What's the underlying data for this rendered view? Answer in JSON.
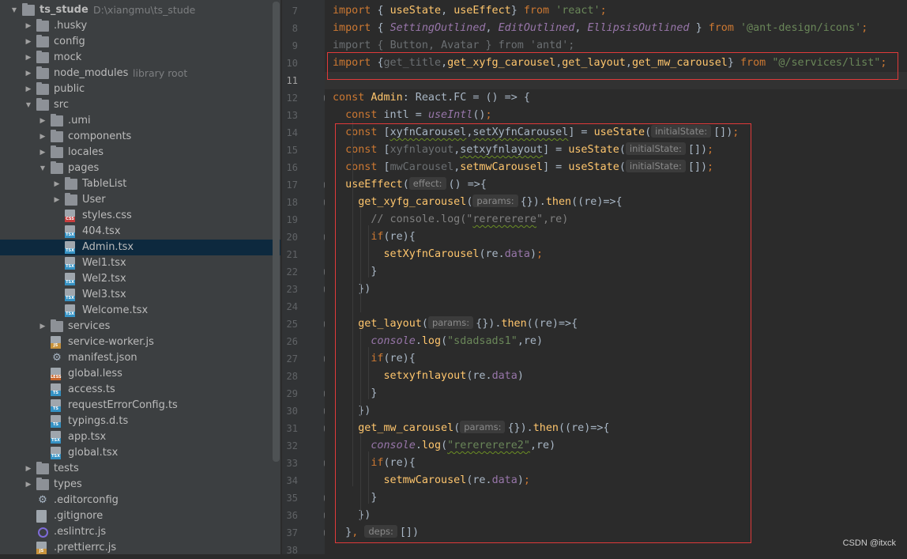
{
  "tree": [
    {
      "label": "ts_stude",
      "extra": "D:\\xiangmu\\ts_stude",
      "type": "folder",
      "depth": 0,
      "arrow": "down",
      "bold": true
    },
    {
      "label": ".husky",
      "type": "folder",
      "depth": 1,
      "arrow": "right"
    },
    {
      "label": "config",
      "type": "folder",
      "depth": 1,
      "arrow": "right"
    },
    {
      "label": "mock",
      "type": "folder",
      "depth": 1,
      "arrow": "right"
    },
    {
      "label": "node_modules",
      "extra": "library root",
      "type": "folder",
      "depth": 1,
      "arrow": "right",
      "highlight": true
    },
    {
      "label": "public",
      "type": "folder",
      "depth": 1,
      "arrow": "right"
    },
    {
      "label": "src",
      "type": "folder",
      "depth": 1,
      "arrow": "down"
    },
    {
      "label": ".umi",
      "type": "folder",
      "depth": 2,
      "arrow": "right"
    },
    {
      "label": "components",
      "type": "folder",
      "depth": 2,
      "arrow": "right"
    },
    {
      "label": "locales",
      "type": "folder",
      "depth": 2,
      "arrow": "right"
    },
    {
      "label": "pages",
      "type": "folder",
      "depth": 2,
      "arrow": "down"
    },
    {
      "label": "TableList",
      "type": "folder",
      "depth": 3,
      "arrow": "right"
    },
    {
      "label": "User",
      "type": "folder",
      "depth": 3,
      "arrow": "right"
    },
    {
      "label": "styles.css",
      "type": "file",
      "badge": "css",
      "depth": 3
    },
    {
      "label": "404.tsx",
      "type": "file",
      "badge": "tsx",
      "depth": 3
    },
    {
      "label": "Admin.tsx",
      "type": "file",
      "badge": "tsx",
      "depth": 3,
      "selected": true
    },
    {
      "label": "Wel1.tsx",
      "type": "file",
      "badge": "tsx",
      "depth": 3
    },
    {
      "label": "Wel2.tsx",
      "type": "file",
      "badge": "tsx",
      "depth": 3
    },
    {
      "label": "Wel3.tsx",
      "type": "file",
      "badge": "tsx",
      "depth": 3
    },
    {
      "label": "Welcome.tsx",
      "type": "file",
      "badge": "tsx",
      "depth": 3
    },
    {
      "label": "services",
      "type": "folder",
      "depth": 2,
      "arrow": "right"
    },
    {
      "label": "service-worker.js",
      "type": "file",
      "badge": "js",
      "depth": 2
    },
    {
      "label": "manifest.json",
      "type": "gear",
      "depth": 2
    },
    {
      "label": "global.less",
      "type": "file",
      "badge": "less",
      "depth": 2
    },
    {
      "label": "access.ts",
      "type": "file",
      "badge": "ts",
      "depth": 2
    },
    {
      "label": "requestErrorConfig.ts",
      "type": "file",
      "badge": "ts",
      "depth": 2
    },
    {
      "label": "typings.d.ts",
      "type": "file",
      "badge": "ts",
      "depth": 2
    },
    {
      "label": "app.tsx",
      "type": "file",
      "badge": "tsx",
      "depth": 2
    },
    {
      "label": "global.tsx",
      "type": "file",
      "badge": "tsx",
      "depth": 2
    },
    {
      "label": "tests",
      "type": "folder",
      "depth": 1,
      "arrow": "right"
    },
    {
      "label": "types",
      "type": "folder",
      "depth": 1,
      "arrow": "right"
    },
    {
      "label": ".editorconfig",
      "type": "gear",
      "depth": 1
    },
    {
      "label": ".gitignore",
      "type": "file",
      "badge": "",
      "depth": 1
    },
    {
      "label": ".eslintrc.js",
      "type": "ring",
      "depth": 1
    },
    {
      "label": ".prettierrc.js",
      "type": "file",
      "badge": "js",
      "depth": 1
    }
  ],
  "line_numbers": [
    "7",
    "8",
    "9",
    "10",
    "11",
    "12",
    "13",
    "14",
    "15",
    "16",
    "17",
    "18",
    "19",
    "20",
    "21",
    "22",
    "23",
    "24",
    "25",
    "26",
    "27",
    "28",
    "29",
    "30",
    "31",
    "32",
    "33",
    "34",
    "35",
    "36",
    "37",
    "38"
  ],
  "current_line": "11",
  "code": [
    [
      [
        "k",
        "import "
      ],
      [
        "v",
        "{ "
      ],
      [
        "f",
        "useState"
      ],
      [
        "v",
        ", "
      ],
      [
        "f",
        "useEffect"
      ],
      [
        "v",
        "} "
      ],
      [
        "k",
        "from "
      ],
      [
        "s",
        "'react'"
      ],
      [
        "k",
        ";"
      ]
    ],
    [
      [
        "k",
        "import "
      ],
      [
        "v",
        "{ "
      ],
      [
        "i",
        "SettingOutlined"
      ],
      [
        "v",
        ", "
      ],
      [
        "i",
        "EditOutlined"
      ],
      [
        "v",
        ", "
      ],
      [
        "i",
        "EllipsisOutlined "
      ],
      [
        "v",
        "} "
      ],
      [
        "k",
        "from "
      ],
      [
        "s",
        "'@ant-design/icons'"
      ],
      [
        "k",
        ";"
      ]
    ],
    [
      [
        "faded",
        "import { "
      ],
      [
        "faded",
        "Button"
      ],
      [
        "faded",
        ", "
      ],
      [
        "faded",
        "Avatar"
      ],
      [
        "faded",
        " } from 'antd';"
      ]
    ],
    [
      [
        "k",
        "import "
      ],
      [
        "v",
        "{"
      ],
      [
        "faded",
        "get_title"
      ],
      [
        "v",
        ","
      ],
      [
        "f",
        "get_xyfg_carousel"
      ],
      [
        "v",
        ","
      ],
      [
        "f",
        "get_layout"
      ],
      [
        "v",
        ","
      ],
      [
        "f",
        "get_mw_carousel"
      ],
      [
        "v",
        "} "
      ],
      [
        "k",
        "from "
      ],
      [
        "s",
        "\"@/services/list\""
      ],
      [
        "k",
        ";"
      ]
    ],
    [],
    [
      [
        "k",
        "const "
      ],
      [
        "f",
        "Admin"
      ],
      [
        "v",
        ": React.FC = () => {"
      ]
    ],
    [
      [
        "v",
        "  "
      ],
      [
        "k",
        "const "
      ],
      [
        "v",
        "intl = "
      ],
      [
        "i",
        "useIntl"
      ],
      [
        "v",
        "()"
      ],
      [
        "k",
        ";"
      ]
    ],
    [
      [
        "v",
        "  "
      ],
      [
        "k",
        "const "
      ],
      [
        "v",
        "["
      ],
      [
        "wavy",
        "xyfnCarousel"
      ],
      [
        "v",
        ","
      ],
      [
        "wavy",
        "setXyfnCarousel"
      ],
      [
        "v",
        "] = "
      ],
      [
        "f",
        "useState"
      ],
      [
        "v",
        "("
      ],
      [
        "hint",
        "initialState:"
      ],
      [
        "v",
        "[])"
      ],
      [
        "k",
        ";"
      ]
    ],
    [
      [
        "v",
        "  "
      ],
      [
        "k",
        "const "
      ],
      [
        "v",
        "["
      ],
      [
        "faded",
        "xyfnlayout"
      ],
      [
        "v",
        ","
      ],
      [
        "wavy",
        "setxyfnlayout"
      ],
      [
        "v",
        "] = "
      ],
      [
        "f",
        "useState"
      ],
      [
        "v",
        "("
      ],
      [
        "hint",
        "initialState:"
      ],
      [
        "v",
        "[])"
      ],
      [
        "k",
        ";"
      ]
    ],
    [
      [
        "v",
        "  "
      ],
      [
        "k",
        "const "
      ],
      [
        "v",
        "["
      ],
      [
        "faded",
        "mwCarousel"
      ],
      [
        "v",
        ","
      ],
      [
        "f",
        "setmwCarousel"
      ],
      [
        "v",
        "] = "
      ],
      [
        "f",
        "useState"
      ],
      [
        "v",
        "("
      ],
      [
        "hint",
        "initialState:"
      ],
      [
        "v",
        "[])"
      ],
      [
        "k",
        ";"
      ]
    ],
    [
      [
        "v",
        "  "
      ],
      [
        "f",
        "useEffect"
      ],
      [
        "v",
        "("
      ],
      [
        "hint",
        "effect:"
      ],
      [
        "v",
        "() =>{"
      ]
    ],
    [
      [
        "v",
        "    "
      ],
      [
        "f",
        "get_xyfg_carousel"
      ],
      [
        "v",
        "("
      ],
      [
        "hint",
        "params:"
      ],
      [
        "v",
        "{})."
      ],
      [
        "f",
        "then"
      ],
      [
        "v",
        "((re)=>{"
      ]
    ],
    [
      [
        "v",
        "      "
      ],
      [
        "c",
        "// console.log(\""
      ],
      [
        "cw",
        "rerererere"
      ],
      [
        "c",
        "\",re)"
      ]
    ],
    [
      [
        "v",
        "      "
      ],
      [
        "k",
        "if"
      ],
      [
        "v",
        "(re){"
      ]
    ],
    [
      [
        "v",
        "        "
      ],
      [
        "f",
        "setXyfnCarousel"
      ],
      [
        "v",
        "(re."
      ],
      [
        "p",
        "data"
      ],
      [
        "v",
        ")"
      ],
      [
        "k",
        ";"
      ]
    ],
    [
      [
        "v",
        "      }"
      ]
    ],
    [
      [
        "v",
        "    })"
      ]
    ],
    [],
    [
      [
        "v",
        "    "
      ],
      [
        "f",
        "get_layout"
      ],
      [
        "v",
        "("
      ],
      [
        "hint",
        "params:"
      ],
      [
        "v",
        "{})."
      ],
      [
        "f",
        "then"
      ],
      [
        "v",
        "((re)=>{"
      ]
    ],
    [
      [
        "v",
        "      "
      ],
      [
        "i",
        "console"
      ],
      [
        "v",
        "."
      ],
      [
        "f",
        "log"
      ],
      [
        "v",
        "("
      ],
      [
        "s",
        "\"sdadsads1\""
      ],
      [
        "v",
        ",re)"
      ]
    ],
    [
      [
        "v",
        "      "
      ],
      [
        "k",
        "if"
      ],
      [
        "v",
        "(re){"
      ]
    ],
    [
      [
        "v",
        "        "
      ],
      [
        "f",
        "setxyfnlayout"
      ],
      [
        "v",
        "(re."
      ],
      [
        "p",
        "data"
      ],
      [
        "v",
        ")"
      ]
    ],
    [
      [
        "v",
        "      }"
      ]
    ],
    [
      [
        "v",
        "    })"
      ]
    ],
    [
      [
        "v",
        "    "
      ],
      [
        "f",
        "get_mw_carousel"
      ],
      [
        "v",
        "("
      ],
      [
        "hint",
        "params:"
      ],
      [
        "v",
        "{})."
      ],
      [
        "f",
        "then"
      ],
      [
        "v",
        "((re)=>{"
      ]
    ],
    [
      [
        "v",
        "      "
      ],
      [
        "i",
        "console"
      ],
      [
        "v",
        "."
      ],
      [
        "f",
        "log"
      ],
      [
        "v",
        "("
      ],
      [
        "sw",
        "\"rerererere2\""
      ],
      [
        "v",
        ",re)"
      ]
    ],
    [
      [
        "v",
        "      "
      ],
      [
        "k",
        "if"
      ],
      [
        "v",
        "(re){"
      ]
    ],
    [
      [
        "v",
        "        "
      ],
      [
        "f",
        "setmwCarousel"
      ],
      [
        "v",
        "(re."
      ],
      [
        "p",
        "data"
      ],
      [
        "v",
        ")"
      ],
      [
        "k",
        ";"
      ]
    ],
    [
      [
        "v",
        "      }"
      ]
    ],
    [
      [
        "v",
        "    })"
      ]
    ],
    [
      [
        "v",
        "  }"
      ],
      [
        "k",
        ","
      ],
      [
        "v",
        " "
      ],
      [
        "hint",
        "deps:"
      ],
      [
        "v",
        "[])"
      ]
    ],
    []
  ],
  "watermark": "CSDN @itxck",
  "colors": {
    "highlight_box": "#e03a3a",
    "selection": "#0d293e",
    "keyword": "#cc7832",
    "function": "#ffc66d",
    "string": "#6a8759"
  }
}
